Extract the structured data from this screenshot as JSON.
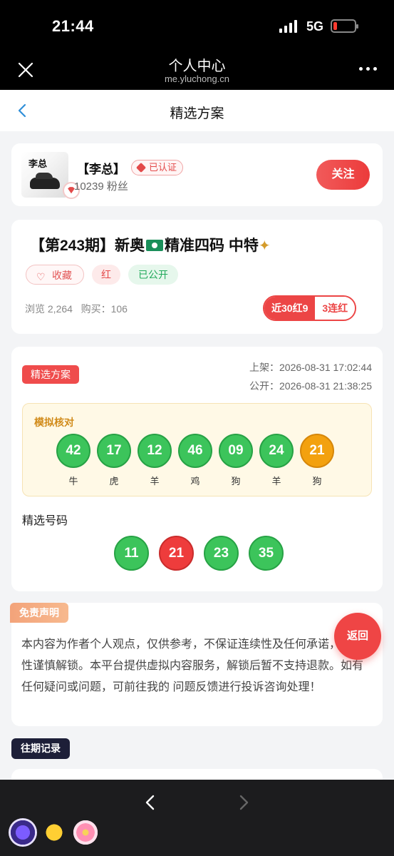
{
  "status_bar": {
    "time": "21:44",
    "network": "5G"
  },
  "browser": {
    "title": "个人中心",
    "url": "me.yluchong.cn"
  },
  "page": {
    "title": "精选方案"
  },
  "author": {
    "name": "【李总】",
    "certified_label": "已认证",
    "fans": "10239 粉丝",
    "follow_label": "关注",
    "avatar_signature": "李总"
  },
  "plan": {
    "title_prefix": "【第243期】新奥",
    "title_suffix": "精准四码 中特",
    "favorite_label": "收藏",
    "red_tag": "红",
    "public_tag": "已公开",
    "stats": "浏览 2,264   购买：106",
    "streak_recent": "近30红9",
    "streak_consecutive": "3连红"
  },
  "detail": {
    "tag": "精选方案",
    "listed_time": "上架：2026-08-31 17:02:44",
    "public_time": "公开：2026-08-31 21:38:25",
    "simulation_label": "模拟核对",
    "sim_balls": [
      {
        "num": "42",
        "zodiac": "牛",
        "color": "green"
      },
      {
        "num": "17",
        "zodiac": "虎",
        "color": "green"
      },
      {
        "num": "12",
        "zodiac": "羊",
        "color": "green"
      },
      {
        "num": "46",
        "zodiac": "鸡",
        "color": "green"
      },
      {
        "num": "09",
        "zodiac": "狗",
        "color": "green"
      },
      {
        "num": "24",
        "zodiac": "羊",
        "color": "green"
      },
      {
        "num": "21",
        "zodiac": "狗",
        "color": "orange"
      }
    ],
    "picks_label": "精选号码",
    "picks": [
      {
        "num": "11",
        "color": "green"
      },
      {
        "num": "21",
        "color": "red"
      },
      {
        "num": "23",
        "color": "green"
      },
      {
        "num": "35",
        "color": "green"
      }
    ]
  },
  "disclaimer": {
    "tag": "免责声明",
    "text": "本内容为作者个人观点，仅供参考，不保证连续性及任何承诺，请理性谨慎解锁。本平台提供虚拟内容服务，解锁后暂不支持退款。如有任何疑问或问题，可前往我的 问题反馈进行投诉咨询处理！"
  },
  "back_button": "返回",
  "history_tag": "往期记录"
}
